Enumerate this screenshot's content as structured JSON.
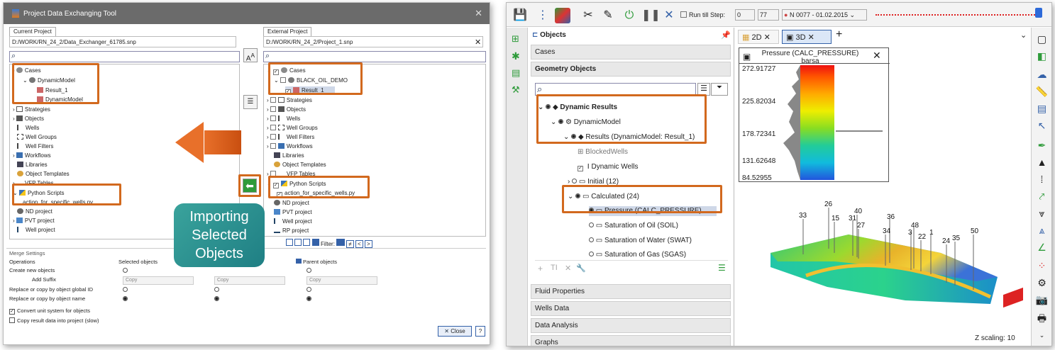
{
  "dialog": {
    "title": "Project Data Exchanging Tool",
    "current_tab": "Current Project",
    "current_path": "D:/WORK/RN_24_2/Data_Exchanger_61785.snp",
    "external_tab": "External Project",
    "external_path": "D:/WORK/RN_24_2/Project_1.snp",
    "current_tree": [
      "Cases",
      "DynamicModel",
      "Result_1",
      "DynamicModel",
      "Strategies",
      "Objects",
      "Wells",
      "Well Groups",
      "Well Filters",
      "Workflows",
      "Libraries",
      "Object Templates",
      "VFP Tables",
      "Python Scripts",
      "action_for_specific_wells.py",
      "ND project",
      "PVT project",
      "Well project"
    ],
    "external_tree": [
      "Cases",
      "BLACK_OIL_DEMO",
      "Result_1",
      "Strategies",
      "Objects",
      "Wells",
      "Well Groups",
      "Well Filters",
      "Workflows",
      "Libraries",
      "Object Templates",
      "VFP Tables",
      "Python Scripts",
      "action_for_specific_wells.py",
      "ND project",
      "PVT project",
      "Well project",
      "RP project"
    ],
    "filter_label": "Filter:",
    "merge": {
      "title": "Merge Settings",
      "col_operations": "Operations",
      "col_selected": "Selected objects",
      "col_parent": "Parent objects",
      "rows": [
        "Create new objects",
        "Add Suffix",
        "Replace or copy by object global ID",
        "Replace or copy by object name"
      ],
      "copy": "Copy",
      "convert_units": "Convert unit system for objects",
      "copy_results": "Copy result data into project (slow)"
    },
    "close_label": "Close",
    "help_label": "?",
    "callout": "Importing Selected Objects",
    "callout_lines": [
      "Importing",
      "Selected",
      "Objects"
    ]
  },
  "app": {
    "run_till_step": "Run till Step:",
    "step_from": "0",
    "step_to": "77",
    "step_date": "N 0077 - 01.02.2015",
    "objects_title": "Objects",
    "sections_top": [
      "Cases",
      "Geometry Objects"
    ],
    "sections_bottom": [
      "Fluid Properties",
      "Wells Data",
      "Data Analysis",
      "Graphs"
    ],
    "tree": [
      "Dynamic Results",
      "DynamicModel",
      "Results (DynamicModel: Result_1)",
      "BlockedWells",
      "Dynamic Wells",
      "Initial (12)",
      "Calculated (24)",
      "Pressure (CALC_PRESSURE)",
      "Saturation of Oil (SOIL)",
      "Saturation of Water (SWAT)",
      "Saturation of Gas (SGAS)"
    ],
    "tabs": [
      "2D",
      "3D"
    ],
    "legend": {
      "title": "Pressure (CALC_PRESSURE)",
      "unit": "barsa",
      "ticks": [
        "272.91727",
        "225.82034",
        "178.72341",
        "131.62648",
        "84.52955"
      ]
    },
    "well_labels": [
      "26",
      "33",
      "15",
      "40",
      "31",
      "27",
      "36",
      "34",
      "3",
      "48",
      "22",
      "1",
      "24",
      "35",
      "50"
    ],
    "z_scaling": "Z scaling: 10"
  }
}
